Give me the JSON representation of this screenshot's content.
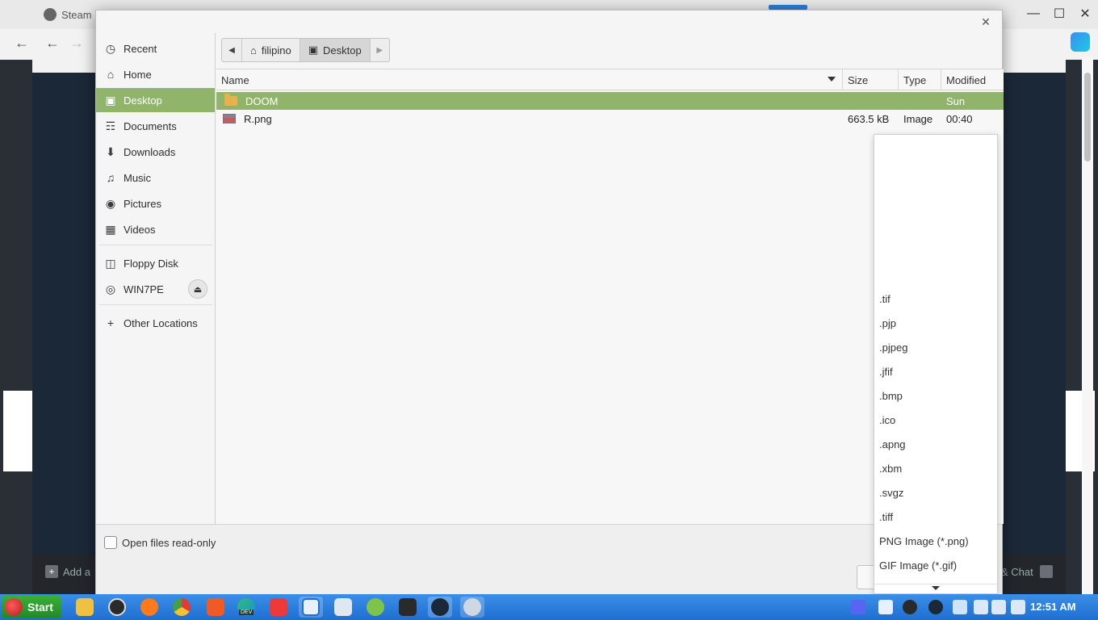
{
  "background": {
    "tab_title": "Steam",
    "add_label": "Add a",
    "chat_label": "& Chat"
  },
  "sidebar": {
    "items": [
      {
        "label": "Recent",
        "icon": "clock-icon"
      },
      {
        "label": "Home",
        "icon": "home-icon"
      },
      {
        "label": "Desktop",
        "icon": "desktop-icon"
      },
      {
        "label": "Documents",
        "icon": "document-icon"
      },
      {
        "label": "Downloads",
        "icon": "download-icon"
      },
      {
        "label": "Music",
        "icon": "music-icon"
      },
      {
        "label": "Pictures",
        "icon": "camera-icon"
      },
      {
        "label": "Videos",
        "icon": "film-icon"
      }
    ],
    "devices": [
      {
        "label": "Floppy Disk",
        "icon": "floppy-icon"
      },
      {
        "label": "WIN7PE",
        "icon": "disc-icon"
      }
    ],
    "other": {
      "label": "Other Locations",
      "icon": "plus-icon"
    }
  },
  "pathbar": {
    "segments": [
      {
        "label": "filipino",
        "icon": "home-icon"
      },
      {
        "label": "Desktop",
        "icon": "desktop-icon"
      }
    ]
  },
  "filelist": {
    "columns": [
      "Name",
      "Size",
      "Type",
      "Modified"
    ],
    "rows": [
      {
        "name": "DOOM",
        "size": "",
        "type": "",
        "modified": "Sun",
        "kind": "folder"
      },
      {
        "name": "R.png",
        "size": "663.5 kB",
        "type": "Image",
        "modified": "00:40",
        "kind": "image"
      }
    ]
  },
  "bottom": {
    "readonly_label": "Open files read-only"
  },
  "filter_popup": {
    "items": [
      ".tif",
      ".pjp",
      ".pjpeg",
      ".jfif",
      ".bmp",
      ".ico",
      ".apng",
      ".xbm",
      ".svgz",
      ".tiff",
      "PNG Image (*.png)",
      "GIF Image (*.gif)"
    ]
  },
  "taskbar": {
    "start_label": "Start",
    "clock": "12:51 AM",
    "dev_badge": "DEV"
  }
}
